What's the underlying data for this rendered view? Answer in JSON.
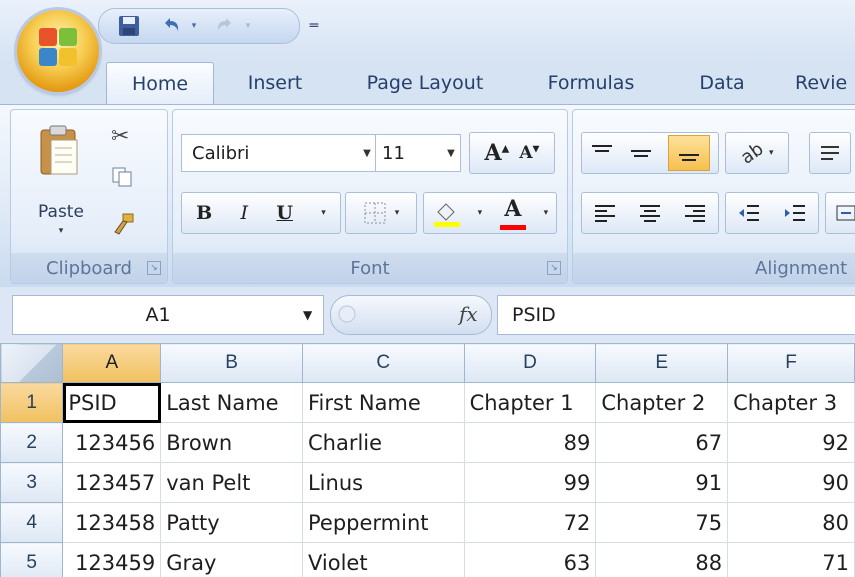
{
  "quick_access": {
    "icons": [
      "save-icon",
      "undo-icon",
      "redo-icon",
      "customize-icon"
    ]
  },
  "tabs": [
    "Home",
    "Insert",
    "Page Layout",
    "Formulas",
    "Data",
    "Revie"
  ],
  "ribbon": {
    "clipboard": {
      "label": "Clipboard",
      "paste_label": "Paste"
    },
    "font": {
      "label": "Font",
      "font_name": "Calibri",
      "font_size": "11",
      "bold": "B",
      "italic": "I",
      "underline": "U",
      "font_color": "A",
      "fill_color": "#ffff00",
      "text_color": "#ff0000"
    },
    "alignment": {
      "label": "Alignment"
    }
  },
  "formula_bar": {
    "name_box": "A1",
    "fx": "fx",
    "formula": "PSID"
  },
  "sheet": {
    "columns": [
      "A",
      "B",
      "C",
      "D",
      "E",
      "F"
    ],
    "rows": [
      {
        "num": "1",
        "cells": [
          "PSID",
          "Last Name",
          "First Name",
          "Chapter 1",
          "Chapter 2",
          "Chapter 3"
        ]
      },
      {
        "num": "2",
        "cells": [
          "123456",
          "Brown",
          "Charlie",
          "89",
          "67",
          "92"
        ]
      },
      {
        "num": "3",
        "cells": [
          "123457",
          "van Pelt",
          "Linus",
          "99",
          "91",
          "90"
        ]
      },
      {
        "num": "4",
        "cells": [
          "123458",
          "Patty",
          "Peppermint",
          "72",
          "75",
          "80"
        ]
      },
      {
        "num": "5",
        "cells": [
          "123459",
          "Gray",
          "Violet",
          "63",
          "88",
          "71"
        ]
      }
    ],
    "active_cell": "A1"
  }
}
